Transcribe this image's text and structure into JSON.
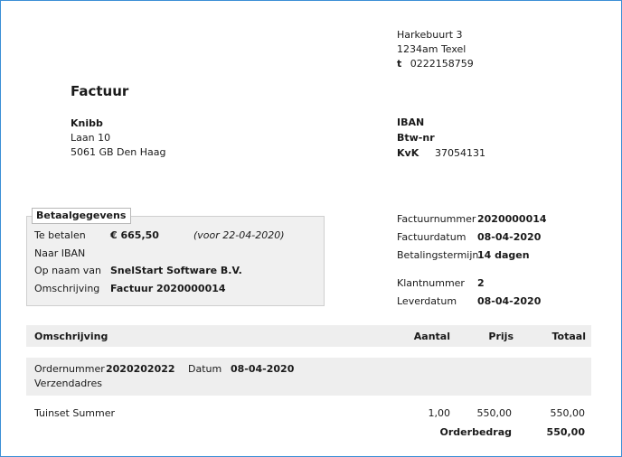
{
  "company": {
    "street": "Harkebuurt 3",
    "city_line": "1234am  Texel",
    "phone_label": "t",
    "phone": "0222158759",
    "iban_label": "IBAN",
    "btw_label": "Btw-nr",
    "kvk_label": "KvK",
    "kvk": "37054131"
  },
  "title": "Factuur",
  "customer": {
    "name": "Knibb",
    "street": "Laan 10",
    "city_line": "5061 GB  Den Haag"
  },
  "payment": {
    "header": "Betaalgegevens",
    "rows": [
      {
        "label": "Te betalen",
        "value": "€ 665,50",
        "note": "(voor 22-04-2020)"
      },
      {
        "label": "Naar IBAN",
        "value": ""
      },
      {
        "label": "Op naam van",
        "value": "SnelStart Software B.V."
      },
      {
        "label": "Omschrijving",
        "value": "Factuur 2020000014"
      }
    ]
  },
  "invoice_info": [
    {
      "label": "Factuurnummer",
      "value": "2020000014"
    },
    {
      "label": "Factuurdatum",
      "value": "08-04-2020"
    },
    {
      "label": "Betalingstermijn",
      "value": "14 dagen"
    },
    {
      "label": "Klantnummer",
      "value": "2"
    },
    {
      "label": "Leverdatum",
      "value": "08-04-2020"
    }
  ],
  "table": {
    "headers": {
      "description": "Omschrijving",
      "quantity": "Aantal",
      "price": "Prijs",
      "total": "Totaal"
    },
    "order": {
      "number_label": "Ordernummer",
      "number": "2020202022",
      "date_label": "Datum",
      "date": "08-04-2020",
      "shipping_label": "Verzendadres"
    },
    "lines": [
      {
        "description": "Tuinset Summer",
        "quantity": "1,00",
        "price": "550,00",
        "total": "550,00"
      }
    ],
    "order_amount_label": "Orderbedrag",
    "order_amount": "550,00"
  }
}
